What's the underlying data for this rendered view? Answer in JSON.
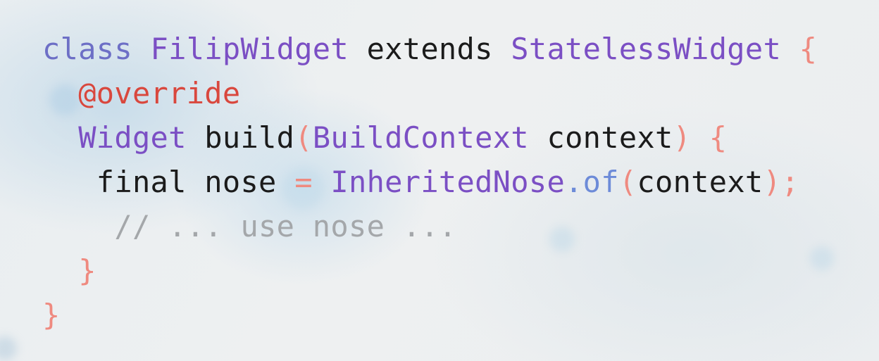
{
  "code": {
    "lines": [
      {
        "indent": "",
        "tokens": [
          {
            "text": "class",
            "kind": "kw"
          },
          {
            "text": " ",
            "kind": "plain"
          },
          {
            "text": "FilipWidget",
            "kind": "ty"
          },
          {
            "text": " extends ",
            "kind": "plain"
          },
          {
            "text": "StatelessWidget",
            "kind": "ty"
          },
          {
            "text": " ",
            "kind": "plain"
          },
          {
            "text": "{",
            "kind": "punct"
          }
        ]
      },
      {
        "indent": "  ",
        "tokens": [
          {
            "text": "@override",
            "kind": "ann"
          }
        ]
      },
      {
        "indent": "  ",
        "tokens": [
          {
            "text": "Widget",
            "kind": "ty"
          },
          {
            "text": " build",
            "kind": "plain"
          },
          {
            "text": "(",
            "kind": "punct"
          },
          {
            "text": "BuildContext",
            "kind": "ty"
          },
          {
            "text": " context",
            "kind": "plain"
          },
          {
            "text": ")",
            "kind": "punct"
          },
          {
            "text": " ",
            "kind": "plain"
          },
          {
            "text": "{",
            "kind": "punct"
          }
        ]
      },
      {
        "indent": "   ",
        "tokens": [
          {
            "text": "final nose ",
            "kind": "plain"
          },
          {
            "text": "=",
            "kind": "punct"
          },
          {
            "text": " ",
            "kind": "plain"
          },
          {
            "text": "InheritedNose",
            "kind": "ty"
          },
          {
            "text": ".of",
            "kind": "method"
          },
          {
            "text": "(",
            "kind": "punct"
          },
          {
            "text": "context",
            "kind": "plain"
          },
          {
            "text": ");",
            "kind": "punct"
          }
        ]
      },
      {
        "indent": "    ",
        "tokens": [
          {
            "text": "// ... use nose ...",
            "kind": "comment"
          }
        ]
      },
      {
        "indent": "  ",
        "tokens": [
          {
            "text": "}",
            "kind": "punct"
          }
        ]
      },
      {
        "indent": "",
        "tokens": [
          {
            "text": "}",
            "kind": "punct"
          }
        ]
      }
    ]
  }
}
